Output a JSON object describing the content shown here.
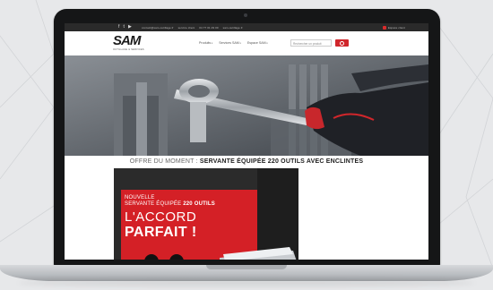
{
  "topbar": {
    "social_icons": [
      "facebook-icon",
      "twitter-icon",
      "youtube-icon"
    ],
    "contact": [
      "contact@sam-outillage.fr",
      "service client",
      "04 77 01 29 00",
      "sam-outillage.fr"
    ],
    "right_label": "Espace client"
  },
  "header": {
    "logo": "SAM",
    "logo_tagline": "OUTILLAGE & SERVICES",
    "nav": [
      "Produits",
      "Services SAM",
      "Espace SAM"
    ],
    "search_placeholder": "Rechercher un produit"
  },
  "offer": {
    "prefix": "OFFRE DU MOMENT :",
    "title": "SERVANTE ÉQUIPÉE 220 OUTILS AVEC ENCLINTES"
  },
  "promo": {
    "line1": "NOUVELLE",
    "line2_prefix": "SERVANTE ÉQUIPÉE",
    "line2_bold": "220 OUTILS",
    "line3": "L'ACCORD",
    "line4": "PARFAIT !"
  },
  "colors": {
    "accent": "#d0262b",
    "topbar": "#2a2a2a",
    "laptop_bezel": "#151617"
  }
}
